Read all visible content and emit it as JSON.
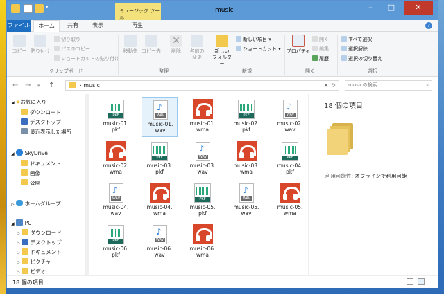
{
  "window": {
    "title": "music"
  },
  "context_tab": {
    "label": "ミュージック ツール"
  },
  "tabs": [
    "ファイル",
    "ホーム",
    "共有",
    "表示",
    "再生"
  ],
  "ribbon": {
    "clipboard": {
      "copy": "コピー",
      "paste": "貼り付け",
      "cut": "切り取り",
      "copy_path": "パスのコピー",
      "paste_shortcut": "ショートカットの貼り付け",
      "label": "クリップボード"
    },
    "organize": {
      "move_to": "移動先",
      "copy_to": "コピー先",
      "delete": "削除",
      "rename_1": "名前の",
      "rename_2": "変更",
      "label": "整理"
    },
    "new": {
      "new_folder_1": "新しい",
      "new_folder_2": "フォルダー",
      "new_item": "新しい項目",
      "shortcut": "ショートカット",
      "label": "新規"
    },
    "open": {
      "properties": "プロパティ",
      "open": "開く",
      "edit": "編集",
      "history": "履歴",
      "label": "開く"
    },
    "select": {
      "select_all": "すべて選択",
      "select_none": "選択解除",
      "invert": "選択の切り替え",
      "label": "選択"
    }
  },
  "address": {
    "path": "music",
    "search_placeholder": "musicの検索"
  },
  "nav": {
    "favorites": "お気に入り",
    "fav_items": [
      "ダウンロード",
      "デスクトップ",
      "最近表示した場所"
    ],
    "skydrive": "SkyDrive",
    "sky_items": [
      "ドキュメント",
      "画像",
      "公開"
    ],
    "homegroup": "ホームグループ",
    "pc": "PC",
    "pc_items": [
      "ダウンロード",
      "デスクトップ",
      "ドキュメント",
      "ピクチャ",
      "ビデオ"
    ]
  },
  "files": [
    {
      "name": "music-01.pkf",
      "type": "pkf"
    },
    {
      "name": "music-01.wav",
      "type": "wav",
      "selected": true
    },
    {
      "name": "music-01.wma",
      "type": "wma"
    },
    {
      "name": "music-02.pkf",
      "type": "pkf"
    },
    {
      "name": "music-02.wav",
      "type": "wav"
    },
    {
      "name": "music-02.wma",
      "type": "wma"
    },
    {
      "name": "music-03.pkf",
      "type": "pkf"
    },
    {
      "name": "music-03.wav",
      "type": "wav"
    },
    {
      "name": "music-03.wma",
      "type": "wma"
    },
    {
      "name": "music-04.pkf",
      "type": "pkf"
    },
    {
      "name": "music-04.wav",
      "type": "wav"
    },
    {
      "name": "music-04.wma",
      "type": "wma"
    },
    {
      "name": "music-05.pkf",
      "type": "pkf"
    },
    {
      "name": "music-05.wav",
      "type": "wav"
    },
    {
      "name": "music-05.wma",
      "type": "wma"
    },
    {
      "name": "music-06.pkf",
      "type": "pkf"
    },
    {
      "name": "music-06.wav",
      "type": "wav"
    },
    {
      "name": "music-06.wma",
      "type": "wma"
    }
  ],
  "preview": {
    "count": "18 個の項目",
    "availability_label": "利用可能性:",
    "availability_value": "オフラインで利用可能"
  },
  "status": {
    "count": "18 個の項目"
  },
  "icon_tags": {
    "pkf": "PKF",
    "wav": "WAV"
  },
  "colors": {
    "titlebar": "#5c9ad7",
    "file_tab": "#1e6ec2",
    "context_tab": "#f3e27b",
    "close": "#c0392b",
    "wma": "#d9472b",
    "pkf": "#1d6a5a",
    "selection": "#e5f1fb"
  }
}
